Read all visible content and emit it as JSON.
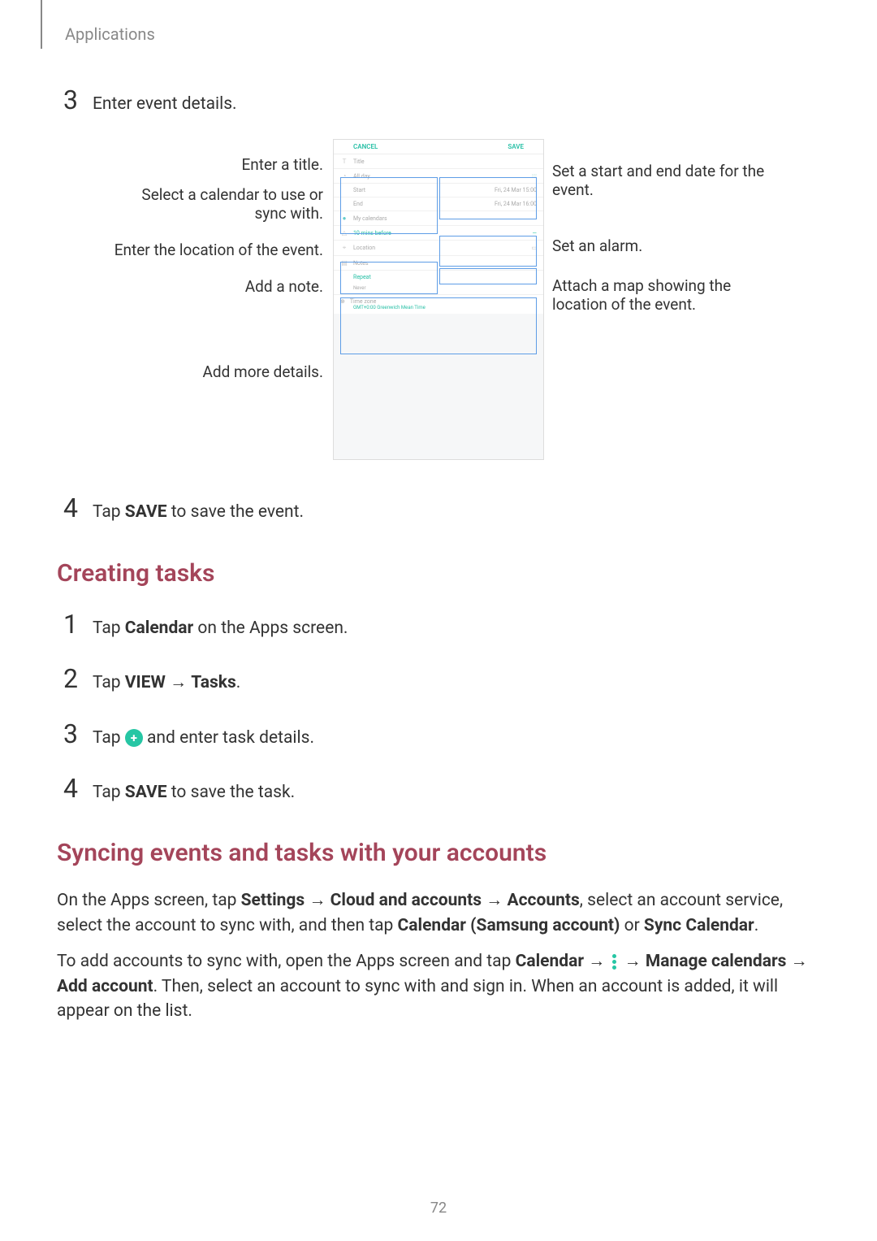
{
  "header": "Applications",
  "page_number": "72",
  "step3": {
    "num": "3",
    "text": "Enter event details."
  },
  "diagram": {
    "left_callouts": {
      "title": "Enter a title.",
      "calendar_l1": "Select a calendar to use or",
      "calendar_l2": "sync with.",
      "location": "Enter the location of the event.",
      "note": "Add a note.",
      "more": "Add more details."
    },
    "right_callouts": {
      "date_l1": "Set a start and end date for the",
      "date_l2": "event.",
      "alarm": "Set an alarm.",
      "map_l1": "Attach a map showing the",
      "map_l2": "location of the event."
    },
    "phone": {
      "cancel": "CANCEL",
      "save": "SAVE",
      "title_placeholder": "Title",
      "allday": "All day",
      "start_label": "Start",
      "start_val": "Fri, 24 Mar  15:00",
      "end_label": "End",
      "end_val": "Fri, 24 Mar  16:00",
      "mycal": "My calendars",
      "reminder": "10 mins before",
      "location": "Location",
      "notes": "Notes",
      "repeat": "Repeat",
      "repeat_val": "Never",
      "timezone": "Time zone",
      "timezone_val": "GMT+0:00 Greenwich Mean Time"
    }
  },
  "step4a": {
    "num": "4",
    "pre": "Tap ",
    "bold": "SAVE",
    "post": " to save the event."
  },
  "h2a": "Creating tasks",
  "steps_tasks": {
    "s1": {
      "num": "1",
      "pre": "Tap ",
      "b1": "Calendar",
      "post": " on the Apps screen."
    },
    "s2": {
      "num": "2",
      "pre": "Tap ",
      "b1": "VIEW",
      "arrow": " → ",
      "b2": "Tasks",
      "post": "."
    },
    "s3": {
      "num": "3",
      "pre": "Tap ",
      "post": " and enter task details."
    },
    "s4": {
      "num": "4",
      "pre": "Tap ",
      "b1": "SAVE",
      "post": " to save the task."
    }
  },
  "h2b": "Syncing events and tasks with your accounts",
  "sync_p1": {
    "t1": "On the Apps screen, tap ",
    "b1": "Settings",
    "a1": " → ",
    "b2": "Cloud and accounts",
    "a2": " → ",
    "b3": "Accounts",
    "t2": ", select an account service, select the account to sync with, and then tap ",
    "b4": "Calendar (Samsung account)",
    "t3": " or ",
    "b5": "Sync Calendar",
    "t4": "."
  },
  "sync_p2": {
    "t1": "To add accounts to sync with, open the Apps screen and tap ",
    "b1": "Calendar",
    "a1": " → ",
    "a2": " → ",
    "b2": "Manage calendars",
    "a3": " → ",
    "b3": "Add account",
    "t2": ". Then, select an account to sync with and sign in. When an account is added, it will appear on the list."
  }
}
